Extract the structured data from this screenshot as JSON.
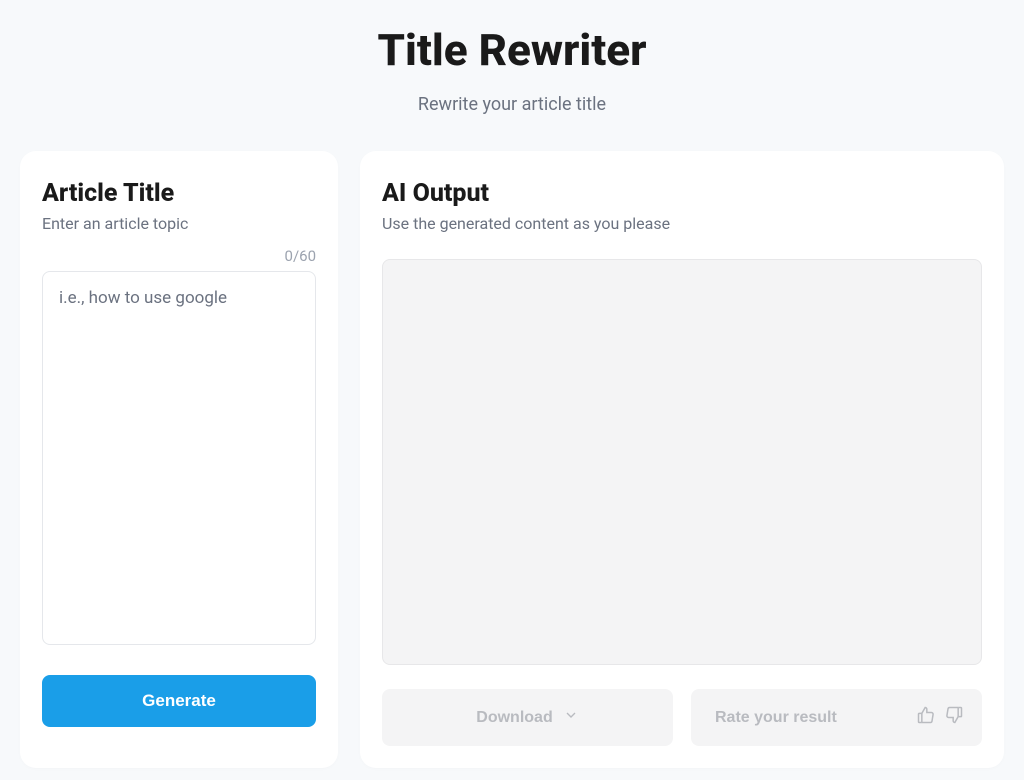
{
  "header": {
    "title": "Title Rewriter",
    "subtitle": "Rewrite your article title"
  },
  "input_panel": {
    "title": "Article Title",
    "subtitle": "Enter an article topic",
    "char_counter": "0/60",
    "placeholder": "i.e., how to use google",
    "generate_label": "Generate"
  },
  "output_panel": {
    "title": "AI Output",
    "subtitle": "Use the generated content as you please",
    "download_label": "Download",
    "rate_label": "Rate your result"
  }
}
